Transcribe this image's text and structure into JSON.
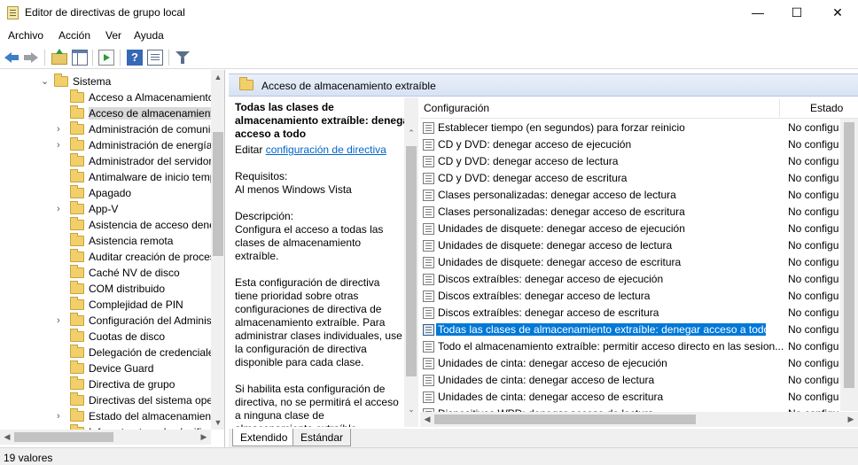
{
  "window": {
    "title": "Editor de directivas de grupo local",
    "minimize": "—",
    "maximize": "☐",
    "close": "✕"
  },
  "menu": [
    "Archivo",
    "Acción",
    "Ver",
    "Ayuda"
  ],
  "tree": {
    "root": "Sistema",
    "items": [
      "Acceso a Almacenamiento",
      "Acceso de almacenamiento",
      "Administración de comunicaciones",
      "Administración de energía",
      "Administrador del servidor",
      "Antimalware de inicio temprano",
      "Apagado",
      "App-V",
      "Asistencia de acceso denegado",
      "Asistencia remota",
      "Auditar creación de procesos",
      "Caché NV de disco",
      "COM distribuido",
      "Complejidad de PIN",
      "Configuración del Administrador",
      "Cuotas de disco",
      "Delegación de credenciales",
      "Device Guard",
      "Directiva de grupo",
      "Directivas del sistema operativo",
      "Estado del almacenamiento",
      "Infraestructura de clasificación"
    ]
  },
  "header": {
    "title": "Acceso de almacenamiento extraíble"
  },
  "description": {
    "title": "Todas las clases de almacenamiento extraíble: denegar acceso a todo",
    "edit_prefix": "Editar",
    "edit_link": "configuración de directiva",
    "requirements_label": "Requisitos:",
    "requirements_value": "Al menos Windows Vista",
    "description_label": "Descripción:",
    "description_text": "Configura el acceso a todas las clases de almacenamiento extraíble.",
    "paragraph2": "Esta configuración de directiva tiene prioridad sobre otras configuraciones de directiva de almacenamiento extraíble. Para administrar clases individuales, use la configuración de directiva disponible para cada clase.",
    "paragraph3": "Si habilita esta configuración de directiva, no se permitirá el acceso a ninguna clase de almacenamiento extraíble."
  },
  "list": {
    "col_setting": "Configuración",
    "col_state": "Estado",
    "rows": [
      {
        "name": "Establecer tiempo (en segundos) para forzar reinicio",
        "state": "No configu"
      },
      {
        "name": "CD y DVD: denegar acceso de ejecución",
        "state": "No configu"
      },
      {
        "name": "CD y DVD: denegar acceso de lectura",
        "state": "No configu"
      },
      {
        "name": "CD y DVD: denegar acceso de escritura",
        "state": "No configu"
      },
      {
        "name": "Clases personalizadas: denegar acceso de lectura",
        "state": "No configu"
      },
      {
        "name": "Clases personalizadas: denegar acceso de escritura",
        "state": "No configu"
      },
      {
        "name": "Unidades de disquete: denegar acceso de ejecución",
        "state": "No configu"
      },
      {
        "name": "Unidades de disquete: denegar acceso de lectura",
        "state": "No configu"
      },
      {
        "name": "Unidades de disquete: denegar acceso de escritura",
        "state": "No configu"
      },
      {
        "name": "Discos extraíbles: denegar acceso de ejecución",
        "state": "No configu"
      },
      {
        "name": "Discos extraíbles: denegar acceso de lectura",
        "state": "No configu"
      },
      {
        "name": "Discos extraíbles: denegar acceso de escritura",
        "state": "No configu"
      },
      {
        "name": "Todas las clases de almacenamiento extraíble: denegar acceso a todo",
        "state": "No configu"
      },
      {
        "name": "Todo el almacenamiento extraíble: permitir acceso directo en las sesion...",
        "state": "No configu"
      },
      {
        "name": "Unidades de cinta: denegar acceso de ejecución",
        "state": "No configu"
      },
      {
        "name": "Unidades de cinta: denegar acceso de lectura",
        "state": "No configu"
      },
      {
        "name": "Unidades de cinta: denegar acceso de escritura",
        "state": "No configu"
      },
      {
        "name": "Dispositivos WPD: denegar acceso de lectura",
        "state": "No configu"
      }
    ]
  },
  "tabs": [
    "Extendido",
    "Estándar"
  ],
  "status": "19 valores"
}
